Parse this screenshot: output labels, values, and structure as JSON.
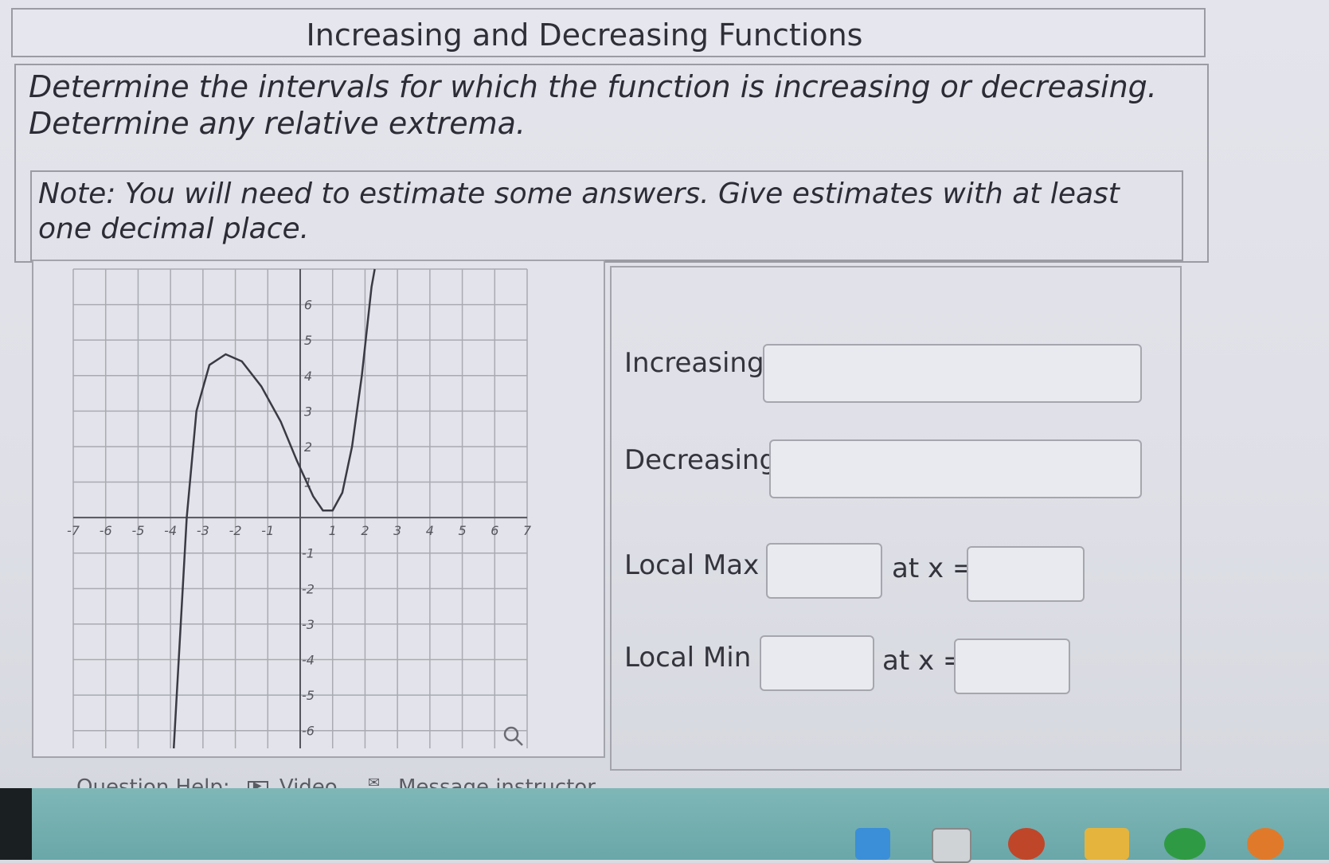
{
  "header": {
    "title": "Increasing and Decreasing Functions"
  },
  "question": {
    "prompt": "Determine the intervals for which the function is increasing or decreasing. Determine any relative extrema.",
    "note": "Note: You will need to estimate some answers. Give estimates with at least one decimal place."
  },
  "graph": {
    "x_ticks": [
      "-7",
      "-6",
      "-5",
      "-4",
      "-3",
      "-2",
      "-1",
      "1",
      "2",
      "3",
      "4",
      "5",
      "6",
      "7"
    ],
    "y_ticks": [
      "6",
      "5",
      "4",
      "3",
      "2",
      "1",
      "-1",
      "-2",
      "-3",
      "-4",
      "-5",
      "-6"
    ],
    "xlim": [
      -7,
      7
    ],
    "ylim": [
      -6.5,
      7
    ],
    "grid": true,
    "curve_points": [
      [
        -3.9,
        -6.5
      ],
      [
        -3.5,
        0
      ],
      [
        -3.2,
        3
      ],
      [
        -2.8,
        4.3
      ],
      [
        -2.3,
        4.6
      ],
      [
        -1.8,
        4.4
      ],
      [
        -1.2,
        3.7
      ],
      [
        -0.6,
        2.7
      ],
      [
        -0.1,
        1.6
      ],
      [
        0.4,
        0.6
      ],
      [
        0.7,
        0.2
      ],
      [
        1.0,
        0.2
      ],
      [
        1.3,
        0.7
      ],
      [
        1.6,
        2.0
      ],
      [
        1.9,
        4.0
      ],
      [
        2.2,
        6.5
      ],
      [
        2.3,
        7
      ]
    ],
    "zoom_icon": "magnifier-icon"
  },
  "answers": {
    "increasing_label": "Increasing:",
    "increasing_value": "",
    "decreasing_label": "Decreasing:",
    "decreasing_value": "",
    "local_max_label": "Local Max =",
    "local_max_value": "",
    "local_max_at_label": "at x =",
    "local_max_at_value": "",
    "local_min_label": "Local Min =",
    "local_min_value": "",
    "local_min_at_label": "at x =",
    "local_min_at_value": ""
  },
  "help": {
    "label": "Question Help:",
    "video_label": "Video",
    "message_label": "Message instructor"
  },
  "colors": {
    "taskbar": "#6aa7a9",
    "grid": "#a9aab2",
    "curve": "#3a3a44"
  }
}
